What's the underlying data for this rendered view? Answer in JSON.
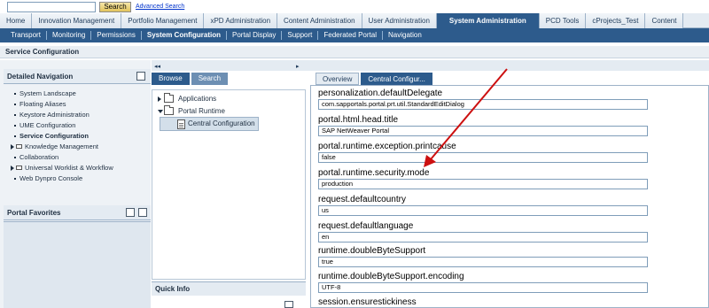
{
  "top": {
    "search_value": "",
    "search_button": "Search",
    "advanced_search": "Advanced Search"
  },
  "tabs1": [
    "Home",
    "Innovation Management",
    "Portfolio Management",
    "xPD Administration",
    "Content Administration",
    "User Administration",
    "System Administration",
    "PCD Tools",
    "cProjects_Test",
    "Content"
  ],
  "tabs1_active": "System Administration",
  "tabs2": [
    "Transport",
    "Monitoring",
    "Permissions",
    "System Configuration",
    "Portal Display",
    "Support",
    "Federated Portal",
    "Navigation"
  ],
  "tabs2_active": "System Configuration",
  "page_title": "Service Configuration",
  "left": {
    "detailed_navigation": "Detailed Navigation",
    "items": [
      {
        "label": "System Landscape",
        "type": "bullet"
      },
      {
        "label": "Floating Aliases",
        "type": "bullet"
      },
      {
        "label": "Keystore Administration",
        "type": "bullet"
      },
      {
        "label": "UME Configuration",
        "type": "bullet"
      },
      {
        "label": "Service Configuration",
        "type": "bullet",
        "active": true
      },
      {
        "label": "Knowledge Management",
        "type": "folder"
      },
      {
        "label": "Collaboration",
        "type": "bullet"
      },
      {
        "label": "Universal Worklist & Workflow",
        "type": "folder"
      },
      {
        "label": "Web Dynpro Console",
        "type": "bullet"
      }
    ],
    "portal_favorites": "Portal Favorites"
  },
  "middle": {
    "tabs": [
      "Browse",
      "Search"
    ],
    "tree": [
      "Applications",
      "Portal Runtime",
      "Central Configuration"
    ],
    "quick_info": "Quick Info"
  },
  "right": {
    "tabs": [
      "Overview",
      "Central Configur..."
    ],
    "props": [
      {
        "name": "personalization.defaultDelegate",
        "value": "com.sapportals.portal.prt.util.StandardEditDialog"
      },
      {
        "name": "portal.html.head.title",
        "value": "SAP NetWeaver Portal"
      },
      {
        "name": "portal.runtime.exception.printcause",
        "value": "false"
      },
      {
        "name": "portal.runtime.security.mode",
        "value": "production"
      },
      {
        "name": "request.defaultcountry",
        "value": "us"
      },
      {
        "name": "request.defaultlanguage",
        "value": "en"
      },
      {
        "name": "runtime.doubleByteSupport",
        "value": "true"
      },
      {
        "name": "runtime.doubleByteSupport.encoding",
        "value": "UTF-8"
      },
      {
        "name": "session.ensurestickiness",
        "value": ""
      }
    ]
  },
  "colors": {
    "nav_blue": "#2d5b8c",
    "arrow_red": "#cc1010"
  }
}
